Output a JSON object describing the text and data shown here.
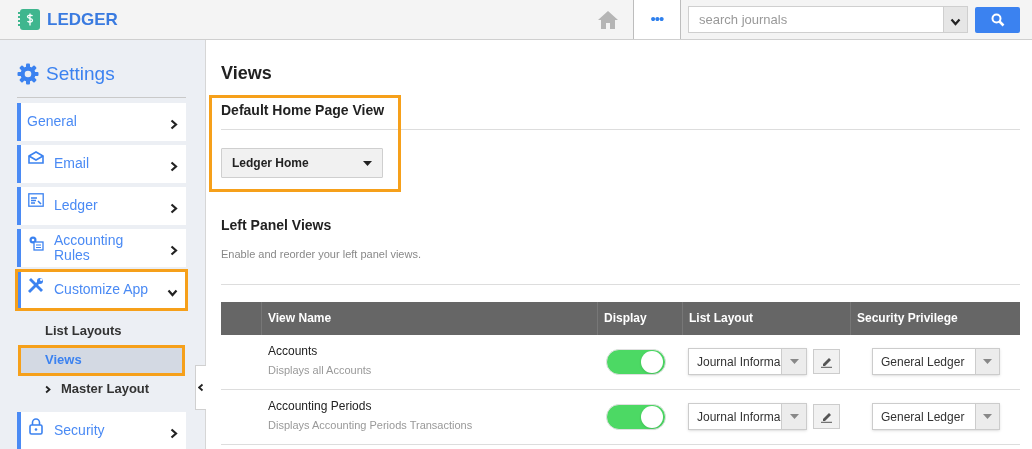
{
  "header": {
    "app_name": "LEDGER",
    "more": "•••",
    "search": {
      "placeholder": "search journals"
    }
  },
  "sidebar": {
    "title": "Settings",
    "items": [
      {
        "label": "General",
        "expanded": false,
        "highlighted": false
      },
      {
        "label": "Email",
        "expanded": false,
        "highlighted": false
      },
      {
        "label": "Ledger",
        "expanded": false,
        "highlighted": false
      },
      {
        "label": "Accounting Rules",
        "expanded": false,
        "highlighted": false
      },
      {
        "label": "Customize App",
        "expanded": true,
        "highlighted": true,
        "children": [
          {
            "label": "List Layouts",
            "selected": false,
            "highlighted": false,
            "has_arrow": false
          },
          {
            "label": "Views",
            "selected": true,
            "highlighted": true,
            "has_arrow": false
          },
          {
            "label": "Master Layout",
            "selected": false,
            "highlighted": false,
            "has_arrow": true
          }
        ]
      },
      {
        "label": "Security",
        "expanded": false,
        "highlighted": false
      }
    ]
  },
  "main": {
    "title": "Views",
    "default_view": {
      "heading": "Default Home Page View",
      "value": "Ledger Home",
      "highlighted": true
    },
    "left_panel": {
      "heading": "Left Panel Views",
      "description": "Enable and reorder your left panel views.",
      "table": {
        "columns": [
          "View Name",
          "Display",
          "List Layout",
          "Security Privilege"
        ],
        "rows": [
          {
            "name": "Accounts",
            "description": "Displays all Accounts",
            "on": true,
            "list_layout": "Journal Informa",
            "privilege": "General Ledger"
          },
          {
            "name": "Accounting Periods",
            "description": "Displays Accounting Periods Transactions",
            "on": true,
            "list_layout": "Journal Informa",
            "privilege": "General Ledger"
          }
        ]
      }
    }
  }
}
